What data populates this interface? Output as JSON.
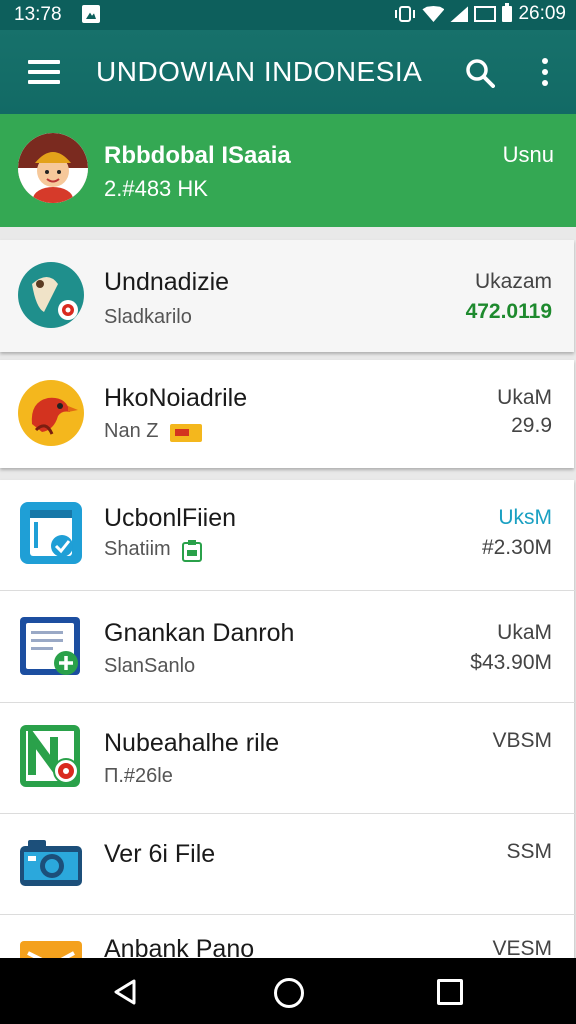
{
  "status_bar": {
    "time": "13:78",
    "right_text": "26:09"
  },
  "app_bar": {
    "title": "UNDOWIAN INDONESIA"
  },
  "account": {
    "name": "Rbbdobal ISaaia",
    "detail": "2.#483 HK",
    "right_label": "Usnu"
  },
  "items": [
    {
      "title": "Undnadizie",
      "subtitle": "Sladkarilo",
      "right_top": "Ukazam",
      "right_bottom": "472.0119",
      "icon": "android-app-icon"
    },
    {
      "title": "HkoNoiadrile",
      "subtitle": "Nan Z",
      "right_top": "UkaM",
      "right_bottom": "29.9",
      "icon": "bird-app-icon"
    },
    {
      "title": "UcbonlFiien",
      "subtitle": "Shatiim",
      "right_top": "UksM",
      "right_bottom": "#2.30M",
      "icon": "file-check-icon"
    },
    {
      "title": "Gnankan Danroh",
      "subtitle": "SlanSanlo",
      "right_top": "UkaM",
      "right_bottom": "$43.90M",
      "icon": "document-add-icon"
    },
    {
      "title": "Nubeahalhe rile",
      "subtitle": "П.#26le",
      "right_top": "VBSM",
      "right_bottom": "",
      "icon": "n-record-icon"
    },
    {
      "title": "Ver 6i File",
      "subtitle": "",
      "right_top": "SSM",
      "right_bottom": "",
      "icon": "camera-icon"
    },
    {
      "title": "Anbank Pano",
      "subtitle": "",
      "right_top": "VESM",
      "right_bottom": "",
      "icon": "folder-icon"
    }
  ],
  "colors": {
    "app_bar": "#126a65",
    "account_bg": "#34a853",
    "accent_green": "#1e8a2e",
    "accent_teal": "#1aa0c2"
  }
}
